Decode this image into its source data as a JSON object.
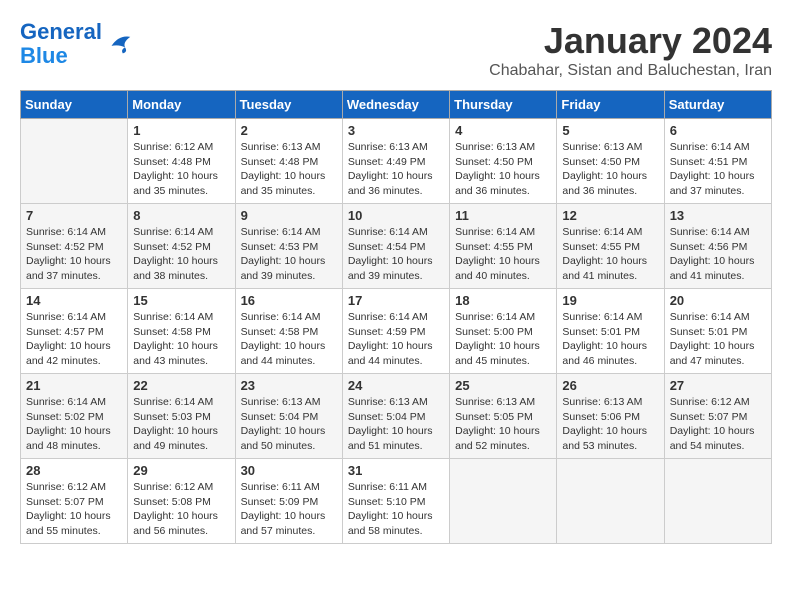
{
  "header": {
    "logo_line1": "General",
    "logo_line2": "Blue",
    "title": "January 2024",
    "subtitle": "Chabahar, Sistan and Baluchestan, Iran"
  },
  "weekdays": [
    "Sunday",
    "Monday",
    "Tuesday",
    "Wednesday",
    "Thursday",
    "Friday",
    "Saturday"
  ],
  "weeks": [
    [
      {
        "day": "",
        "info": ""
      },
      {
        "day": "1",
        "info": "Sunrise: 6:12 AM\nSunset: 4:48 PM\nDaylight: 10 hours\nand 35 minutes."
      },
      {
        "day": "2",
        "info": "Sunrise: 6:13 AM\nSunset: 4:48 PM\nDaylight: 10 hours\nand 35 minutes."
      },
      {
        "day": "3",
        "info": "Sunrise: 6:13 AM\nSunset: 4:49 PM\nDaylight: 10 hours\nand 36 minutes."
      },
      {
        "day": "4",
        "info": "Sunrise: 6:13 AM\nSunset: 4:50 PM\nDaylight: 10 hours\nand 36 minutes."
      },
      {
        "day": "5",
        "info": "Sunrise: 6:13 AM\nSunset: 4:50 PM\nDaylight: 10 hours\nand 36 minutes."
      },
      {
        "day": "6",
        "info": "Sunrise: 6:14 AM\nSunset: 4:51 PM\nDaylight: 10 hours\nand 37 minutes."
      }
    ],
    [
      {
        "day": "7",
        "info": "Sunrise: 6:14 AM\nSunset: 4:52 PM\nDaylight: 10 hours\nand 37 minutes."
      },
      {
        "day": "8",
        "info": "Sunrise: 6:14 AM\nSunset: 4:52 PM\nDaylight: 10 hours\nand 38 minutes."
      },
      {
        "day": "9",
        "info": "Sunrise: 6:14 AM\nSunset: 4:53 PM\nDaylight: 10 hours\nand 39 minutes."
      },
      {
        "day": "10",
        "info": "Sunrise: 6:14 AM\nSunset: 4:54 PM\nDaylight: 10 hours\nand 39 minutes."
      },
      {
        "day": "11",
        "info": "Sunrise: 6:14 AM\nSunset: 4:55 PM\nDaylight: 10 hours\nand 40 minutes."
      },
      {
        "day": "12",
        "info": "Sunrise: 6:14 AM\nSunset: 4:55 PM\nDaylight: 10 hours\nand 41 minutes."
      },
      {
        "day": "13",
        "info": "Sunrise: 6:14 AM\nSunset: 4:56 PM\nDaylight: 10 hours\nand 41 minutes."
      }
    ],
    [
      {
        "day": "14",
        "info": "Sunrise: 6:14 AM\nSunset: 4:57 PM\nDaylight: 10 hours\nand 42 minutes."
      },
      {
        "day": "15",
        "info": "Sunrise: 6:14 AM\nSunset: 4:58 PM\nDaylight: 10 hours\nand 43 minutes."
      },
      {
        "day": "16",
        "info": "Sunrise: 6:14 AM\nSunset: 4:58 PM\nDaylight: 10 hours\nand 44 minutes."
      },
      {
        "day": "17",
        "info": "Sunrise: 6:14 AM\nSunset: 4:59 PM\nDaylight: 10 hours\nand 44 minutes."
      },
      {
        "day": "18",
        "info": "Sunrise: 6:14 AM\nSunset: 5:00 PM\nDaylight: 10 hours\nand 45 minutes."
      },
      {
        "day": "19",
        "info": "Sunrise: 6:14 AM\nSunset: 5:01 PM\nDaylight: 10 hours\nand 46 minutes."
      },
      {
        "day": "20",
        "info": "Sunrise: 6:14 AM\nSunset: 5:01 PM\nDaylight: 10 hours\nand 47 minutes."
      }
    ],
    [
      {
        "day": "21",
        "info": "Sunrise: 6:14 AM\nSunset: 5:02 PM\nDaylight: 10 hours\nand 48 minutes."
      },
      {
        "day": "22",
        "info": "Sunrise: 6:14 AM\nSunset: 5:03 PM\nDaylight: 10 hours\nand 49 minutes."
      },
      {
        "day": "23",
        "info": "Sunrise: 6:13 AM\nSunset: 5:04 PM\nDaylight: 10 hours\nand 50 minutes."
      },
      {
        "day": "24",
        "info": "Sunrise: 6:13 AM\nSunset: 5:04 PM\nDaylight: 10 hours\nand 51 minutes."
      },
      {
        "day": "25",
        "info": "Sunrise: 6:13 AM\nSunset: 5:05 PM\nDaylight: 10 hours\nand 52 minutes."
      },
      {
        "day": "26",
        "info": "Sunrise: 6:13 AM\nSunset: 5:06 PM\nDaylight: 10 hours\nand 53 minutes."
      },
      {
        "day": "27",
        "info": "Sunrise: 6:12 AM\nSunset: 5:07 PM\nDaylight: 10 hours\nand 54 minutes."
      }
    ],
    [
      {
        "day": "28",
        "info": "Sunrise: 6:12 AM\nSunset: 5:07 PM\nDaylight: 10 hours\nand 55 minutes."
      },
      {
        "day": "29",
        "info": "Sunrise: 6:12 AM\nSunset: 5:08 PM\nDaylight: 10 hours\nand 56 minutes."
      },
      {
        "day": "30",
        "info": "Sunrise: 6:11 AM\nSunset: 5:09 PM\nDaylight: 10 hours\nand 57 minutes."
      },
      {
        "day": "31",
        "info": "Sunrise: 6:11 AM\nSunset: 5:10 PM\nDaylight: 10 hours\nand 58 minutes."
      },
      {
        "day": "",
        "info": ""
      },
      {
        "day": "",
        "info": ""
      },
      {
        "day": "",
        "info": ""
      }
    ]
  ]
}
